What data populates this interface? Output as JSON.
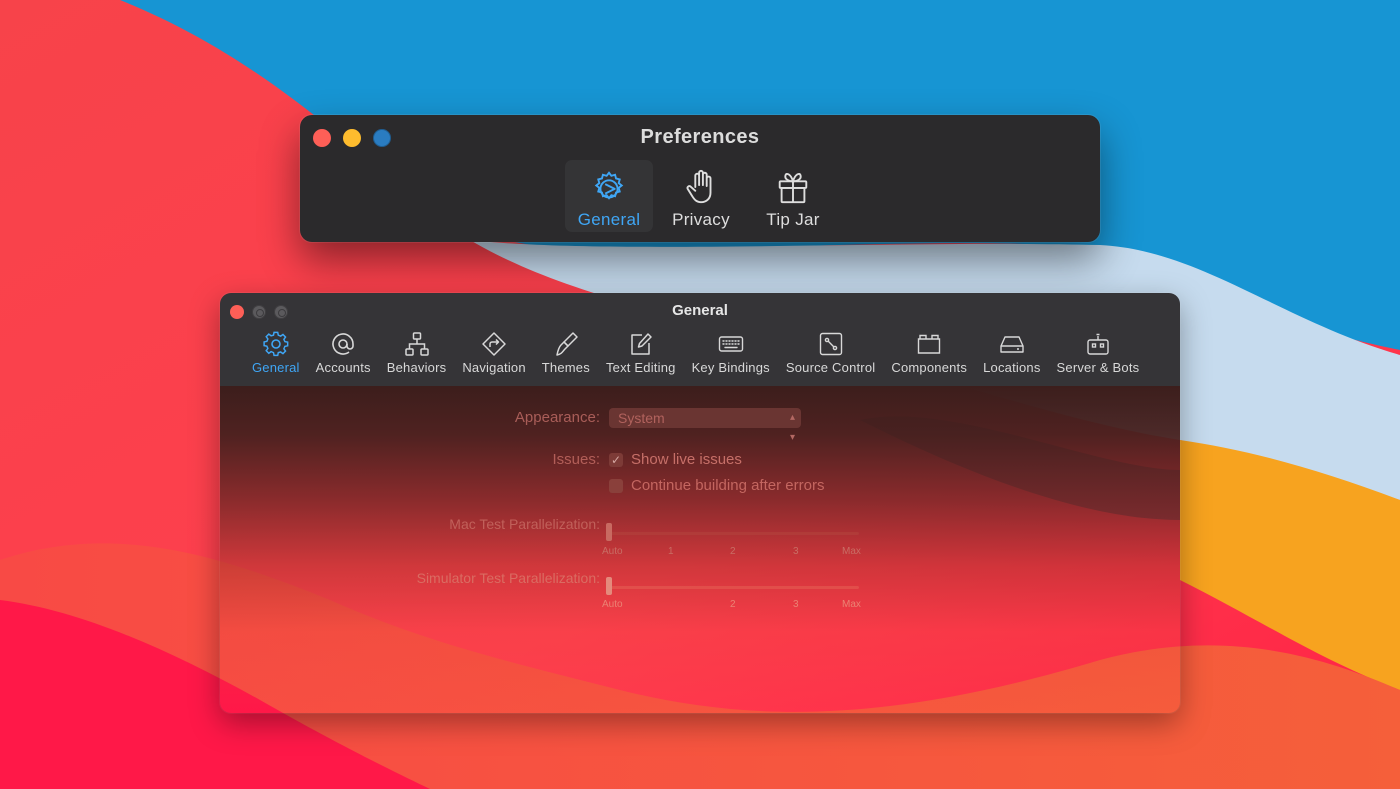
{
  "colors": {
    "wallpaper_blue": "#1794d2",
    "wallpaper_light": "#c8dced",
    "wallpaper_orange": "#f5a31f",
    "wallpaper_red": "#ff3a4d",
    "accent": "#3fa6f5",
    "window_bg": "#2b2a2c"
  },
  "preferences_window": {
    "title": "Preferences",
    "tabs": [
      {
        "label": "General",
        "icon": "gear-compass-icon",
        "active": true
      },
      {
        "label": "Privacy",
        "icon": "hand-icon",
        "active": false
      },
      {
        "label": "Tip Jar",
        "icon": "gift-icon",
        "active": false
      }
    ]
  },
  "general_window": {
    "title": "General",
    "tabs": [
      {
        "label": "General",
        "icon": "gear-icon",
        "active": true
      },
      {
        "label": "Accounts",
        "icon": "at-icon"
      },
      {
        "label": "Behaviors",
        "icon": "hierarchy-icon"
      },
      {
        "label": "Navigation",
        "icon": "navigation-diamond-icon"
      },
      {
        "label": "Themes",
        "icon": "paintbrush-icon"
      },
      {
        "label": "Text Editing",
        "icon": "pencil-square-icon"
      },
      {
        "label": "Key Bindings",
        "icon": "keyboard-icon"
      },
      {
        "label": "Source Control",
        "icon": "source-control-icon"
      },
      {
        "label": "Components",
        "icon": "components-icon"
      },
      {
        "label": "Locations",
        "icon": "drive-icon"
      },
      {
        "label": "Server & Bots",
        "icon": "robot-icon"
      }
    ],
    "settings": {
      "appearance_label": "Appearance:",
      "appearance_value": "System",
      "issues_label": "Issues:",
      "show_live_issues": {
        "label": "Show live issues",
        "checked": true
      },
      "continue_building": {
        "label": "Continue building after errors",
        "checked": false
      },
      "mac_parallel_label": "Mac Test Parallelization:",
      "mac_parallel_ticks": [
        "Auto",
        "1",
        "2",
        "3",
        "Max"
      ],
      "sim_parallel_label": "Simulator Test Parallelization:",
      "sim_parallel_ticks": [
        "Auto",
        "",
        "2",
        "3",
        "Max"
      ]
    }
  }
}
